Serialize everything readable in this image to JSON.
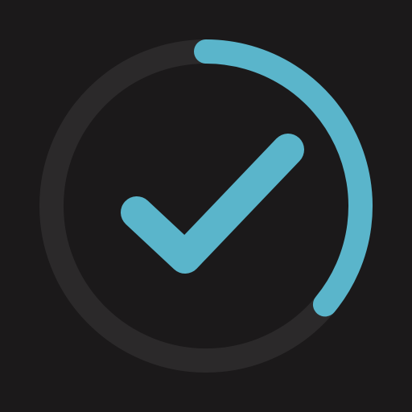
{
  "icon": {
    "name": "checkmark-progress-ring",
    "progress": 0.36
  },
  "colors": {
    "background": "#1b191a",
    "track": "#2b292a",
    "accent": "#5ab5cb"
  }
}
